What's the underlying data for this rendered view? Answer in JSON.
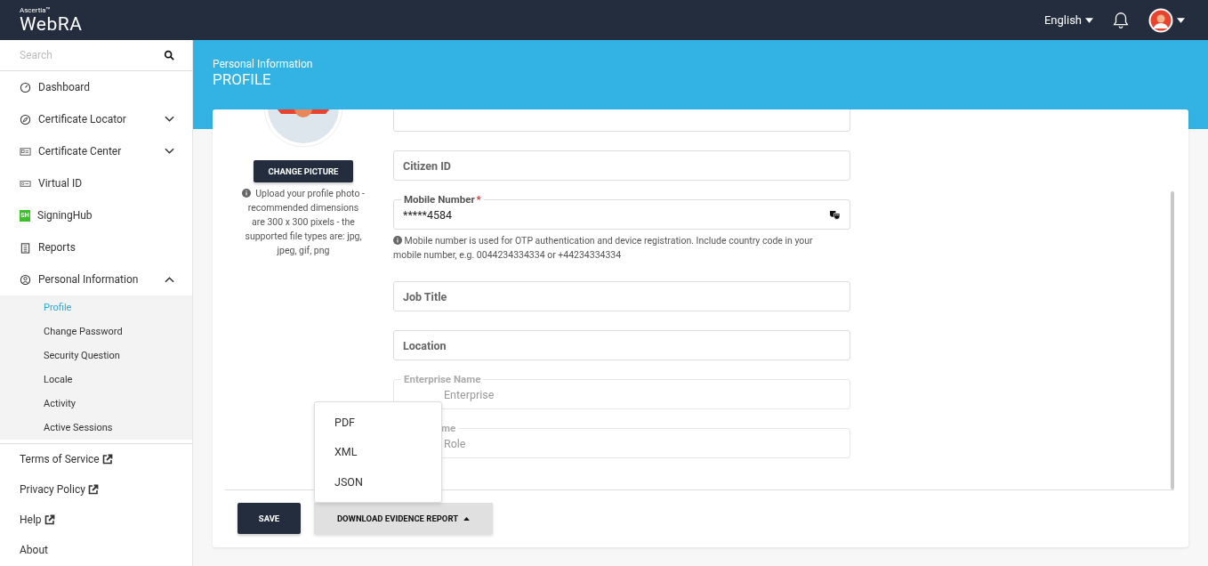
{
  "header": {
    "brand_small": "Ascertia™",
    "brand": "WebRA",
    "language": "English"
  },
  "sidebar": {
    "search": {
      "placeholder": "Search"
    },
    "items": [
      {
        "label": "Dashboard"
      },
      {
        "label": "Certificate Locator",
        "expanded": false
      },
      {
        "label": "Certificate Center",
        "expanded": false
      },
      {
        "label": "Virtual ID"
      },
      {
        "label": "SigningHub",
        "badge": "SH"
      },
      {
        "label": "Reports"
      },
      {
        "label": "Personal Information",
        "expanded": true,
        "children": [
          {
            "label": "Profile",
            "selected": true
          },
          {
            "label": "Change Password",
            "selected": false
          },
          {
            "label": "Security Question",
            "selected": false
          },
          {
            "label": "Locale",
            "selected": false
          },
          {
            "label": "Activity",
            "selected": false
          },
          {
            "label": "Active Sessions",
            "selected": false
          }
        ]
      }
    ],
    "links": [
      {
        "label": "Terms of Service",
        "external": true
      },
      {
        "label": "Privacy Policy",
        "external": true
      },
      {
        "label": "Help",
        "external": true
      },
      {
        "label": "About",
        "external": false
      }
    ]
  },
  "page": {
    "breadcrumb": "Personal Information",
    "title": "PROFILE"
  },
  "profile": {
    "change_picture": "CHANGE PICTURE",
    "picture_hint": "Upload your profile photo - recommended dimensions are 300 x 300 pixels - the supported file types are: jpg, jpeg, gif, png"
  },
  "fields": [
    {
      "kind": "cut"
    },
    {
      "kind": "field",
      "label": "Citizen ID",
      "floated": false,
      "disabled": false
    },
    {
      "kind": "field",
      "label": "Mobile Number",
      "floated": true,
      "required_mark": "*",
      "disabled": false,
      "value": "*****4584",
      "masked": true,
      "hint": "Mobile number is used for OTP authentication and device registration. Include country code in your mobile number, e.g. 0044234334334 or +44234334334"
    },
    {
      "kind": "field",
      "label": "Job Title",
      "floated": false,
      "disabled": false
    },
    {
      "kind": "field",
      "label": "Location",
      "floated": false,
      "disabled": false
    },
    {
      "kind": "field",
      "label": "Enterprise Name",
      "floated": true,
      "disabled": true,
      "covered": false,
      "value": "Enterprise",
      "value_covered": true
    },
    {
      "kind": "field",
      "label": "me",
      "floated": true,
      "disabled": true,
      "covered": true,
      "value": "Role",
      "value_covered": true
    }
  ],
  "actions": {
    "save": "SAVE",
    "download": "DOWNLOAD EVIDENCE REPORT",
    "menu_open": true,
    "menu": [
      "PDF",
      "XML",
      "JSON"
    ]
  }
}
